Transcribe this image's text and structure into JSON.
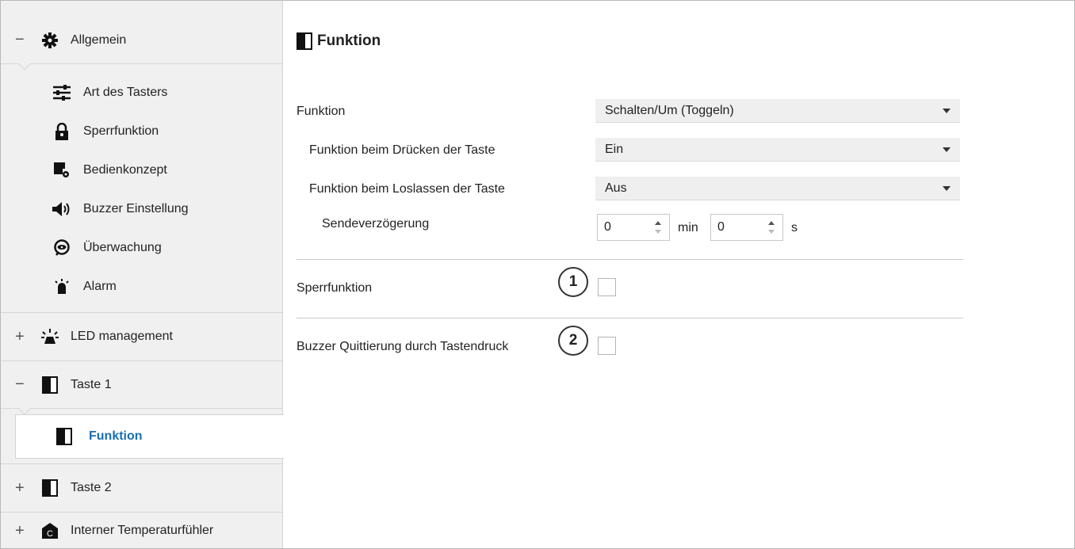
{
  "sidebar": {
    "groups": [
      {
        "toggle": "−",
        "label": "Allgemein",
        "icon": "gear-icon"
      },
      {
        "toggle": "+",
        "label": "LED management",
        "icon": "led-icon"
      },
      {
        "toggle": "−",
        "label": "Taste 1",
        "icon": "button-icon"
      },
      {
        "toggle": "+",
        "label": "Taste 2",
        "icon": "button-icon"
      },
      {
        "toggle": "+",
        "label": "Interner Temperaturfühler",
        "icon": "temperature-sensor-icon"
      }
    ],
    "allgemein_items": [
      {
        "label": "Art des Tasters",
        "icon": "sliders-icon"
      },
      {
        "label": "Sperrfunktion",
        "icon": "lock-icon"
      },
      {
        "label": "Bedienkonzept",
        "icon": "operation-concept-icon"
      },
      {
        "label": "Buzzer Einstellung",
        "icon": "speaker-icon"
      },
      {
        "label": "Überwachung",
        "icon": "eye-icon"
      },
      {
        "label": "Alarm",
        "icon": "alarm-icon"
      }
    ],
    "taste1_items": [
      {
        "label": "Funktion",
        "icon": "button-icon",
        "active": true
      }
    ]
  },
  "panel": {
    "title": "Funktion",
    "params": {
      "funktion": {
        "label": "Funktion",
        "value": "Schalten/Um (Toggeln)"
      },
      "druecken": {
        "label": "Funktion beim Drücken der Taste",
        "value": "Ein"
      },
      "loslassen": {
        "label": "Funktion beim Loslassen der Taste",
        "value": "Aus"
      },
      "sendeverzoegerung": {
        "label": "Sendeverzögerung",
        "min_value": "0",
        "min_unit": "min",
        "sec_value": "0",
        "sec_unit": "s"
      }
    },
    "sperrfunktion": {
      "label": "Sperrfunktion",
      "checked": false,
      "marker": "1"
    },
    "buzzer": {
      "label": "Buzzer Quittierung durch Tastendruck",
      "checked": false,
      "marker": "2"
    }
  },
  "colors": {
    "active_text": "#1a6fb5",
    "sidebar_bg": "#f0f0f0",
    "select_bg": "#efefef"
  }
}
